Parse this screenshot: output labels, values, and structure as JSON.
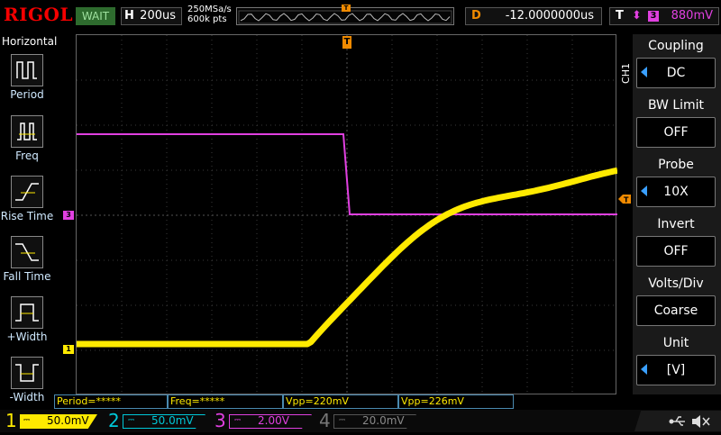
{
  "brand": "RIGOL",
  "run_state": "WAIT",
  "horizontal": {
    "key": "H",
    "timebase": "200us",
    "sample_rate": "250MSa/s",
    "memory_depth": "600k pts"
  },
  "delay": {
    "key": "D",
    "value": "-12.0000000us"
  },
  "trigger": {
    "key": "T",
    "edge": "⬍",
    "source": "3",
    "level": "880mV"
  },
  "left_menu": {
    "title": "Horizontal",
    "items": [
      {
        "label": "Period",
        "icon": "period-icon"
      },
      {
        "label": "Freq",
        "icon": "frequency-icon"
      },
      {
        "label": "Rise Time",
        "icon": "rise-time-icon"
      },
      {
        "label": "Fall Time",
        "icon": "fall-time-icon"
      },
      {
        "label": "+Width",
        "icon": "positive-width-icon"
      },
      {
        "label": "-Width",
        "icon": "negative-width-icon"
      }
    ]
  },
  "right_menu": {
    "channel_tag": "CH1",
    "items": [
      {
        "title": "Coupling",
        "value": "DC"
      },
      {
        "title": "BW Limit",
        "value": "OFF"
      },
      {
        "title": "Probe",
        "value": "10X"
      },
      {
        "title": "Invert",
        "value": "OFF"
      },
      {
        "title": "Volts/Div",
        "value": "Coarse"
      },
      {
        "title": "Unit",
        "value": "[V]"
      }
    ]
  },
  "measurements": [
    {
      "text": "Period=*****"
    },
    {
      "text": "Freq=*****"
    },
    {
      "text": "Vpp=220mV"
    },
    {
      "text": "Vpp=226mV"
    }
  ],
  "channels": [
    {
      "num": "1",
      "scale": "50.0mV",
      "color": "#ffea00",
      "active": true
    },
    {
      "num": "2",
      "scale": "50.0mV",
      "color": "#00c8d8",
      "active": false
    },
    {
      "num": "3",
      "scale": "2.00V",
      "color": "#e040e0",
      "active": false
    },
    {
      "num": "4",
      "scale": "20.0mV",
      "color": "#4a6cff",
      "active": false
    }
  ],
  "colors": {
    "ch1": "#ffea00",
    "ch3": "#e040e0",
    "trigger": "#f08a00",
    "accent": "#3aa0ff"
  },
  "markers": {
    "ch1": "1",
    "ch3": "3",
    "trigger_pos": "T"
  }
}
